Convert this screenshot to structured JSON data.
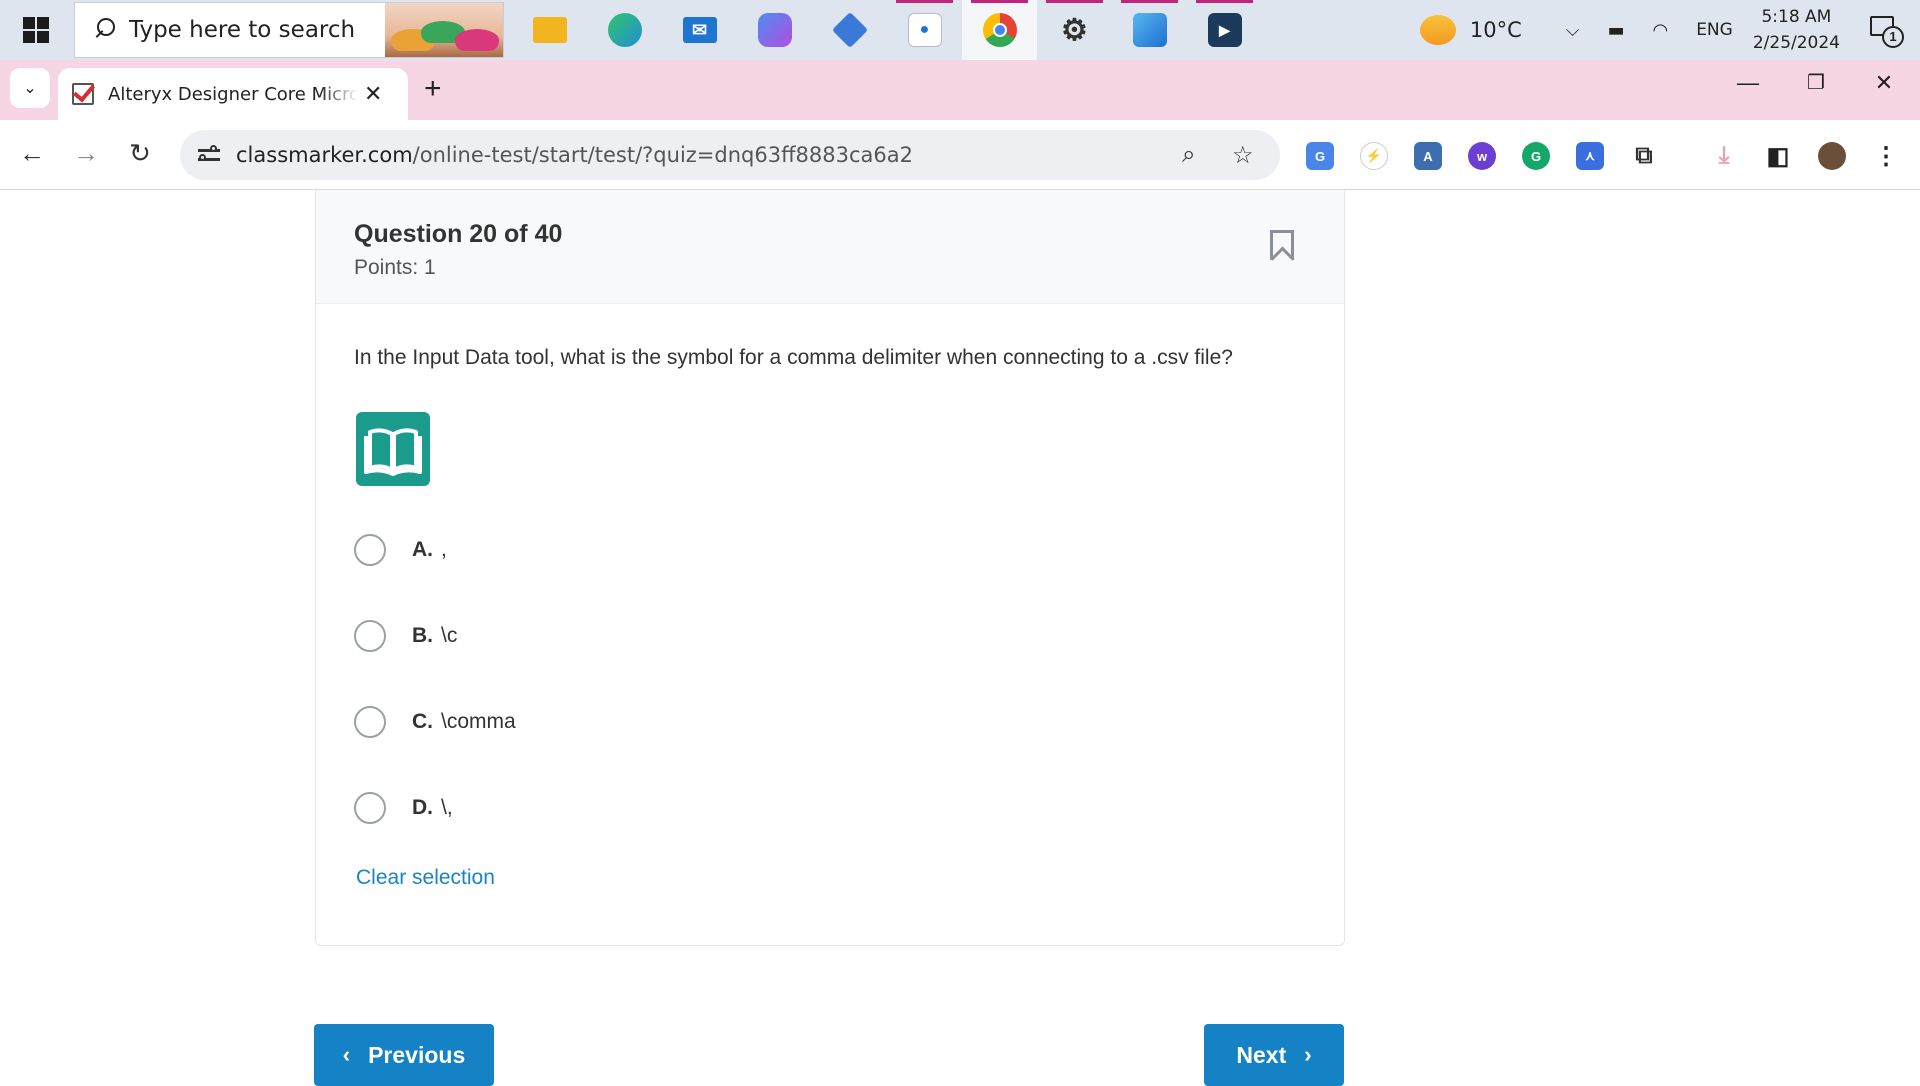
{
  "taskbar": {
    "search_placeholder": "Type here to search",
    "apps": [
      {
        "icon": "file-explorer-icon",
        "color": "#f2b51f"
      },
      {
        "icon": "edge-icon",
        "color": "#1f8fd6"
      },
      {
        "icon": "mail-icon",
        "color": "#1e75d0"
      },
      {
        "icon": "copilot-icon",
        "color": "#7a4ee0"
      },
      {
        "icon": "azure-icon",
        "color": "#3a79d8"
      },
      {
        "icon": "contacts-icon",
        "color": "#e8ecf2"
      },
      {
        "icon": "chrome-icon",
        "color": "#e84235"
      },
      {
        "icon": "settings-icon",
        "color": "#333333"
      },
      {
        "icon": "photos-icon",
        "color": "#1d86d8"
      },
      {
        "icon": "media-player-icon",
        "color": "#1b3a5c"
      }
    ],
    "weather_temp": "10°C",
    "language": "ENG",
    "time": "5:18 AM",
    "date": "2/25/2024",
    "notification_count": "1"
  },
  "browser": {
    "tab_title": "Alteryx Designer Core Micro-Credential",
    "url_domain": "classmarker.com",
    "url_path": "/online-test/start/test/?quiz=dnq63ff8883ca6a2"
  },
  "question": {
    "number_label": "Question 20 of 40",
    "points_label": "Points: 1",
    "text": "In the Input Data tool, what is the symbol for a comma delimiter when connecting to a .csv file?",
    "options": [
      {
        "letter": "A.",
        "text": ","
      },
      {
        "letter": "B.",
        "text": "\\c"
      },
      {
        "letter": "C.",
        "text": "\\comma"
      },
      {
        "letter": "D.",
        "text": "\\,"
      }
    ],
    "clear_label": "Clear selection"
  },
  "nav": {
    "previous_label": "Previous",
    "next_label": "Next"
  },
  "colors": {
    "accent": "#1582c5",
    "link": "#1a84c6",
    "book_icon": "#1a9b8c",
    "tab_strip": "#f6d6e5"
  }
}
